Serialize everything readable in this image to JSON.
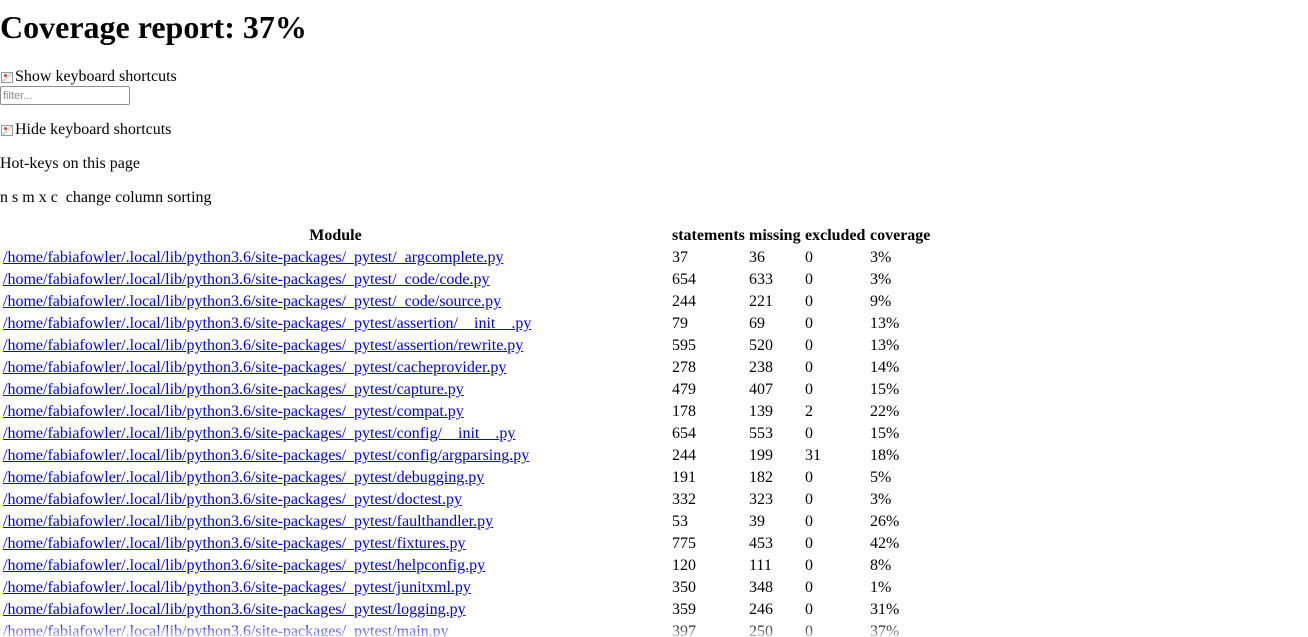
{
  "title": "Coverage report: 37%",
  "show_shortcuts_label": "Show keyboard shortcuts",
  "filter": {
    "placeholder": "filter...",
    "value": ""
  },
  "hide_shortcuts_label": "Hide keyboard shortcuts",
  "hotkeys_heading": "Hot-keys on this page",
  "hotkeys": {
    "keys": [
      "n",
      "s",
      "m",
      "x",
      "c"
    ],
    "description": "change column sorting"
  },
  "table": {
    "columns": [
      "Module",
      "statements",
      "missing",
      "excluded",
      "coverage"
    ],
    "rows": [
      {
        "module": "/home/fabiafowler/.local/lib/python3.6/site-packages/_pytest/_argcomplete.py",
        "statements": "37",
        "missing": "36",
        "excluded": "0",
        "coverage": "3%"
      },
      {
        "module": "/home/fabiafowler/.local/lib/python3.6/site-packages/_pytest/_code/code.py",
        "statements": "654",
        "missing": "633",
        "excluded": "0",
        "coverage": "3%"
      },
      {
        "module": "/home/fabiafowler/.local/lib/python3.6/site-packages/_pytest/_code/source.py",
        "statements": "244",
        "missing": "221",
        "excluded": "0",
        "coverage": "9%"
      },
      {
        "module": "/home/fabiafowler/.local/lib/python3.6/site-packages/_pytest/assertion/__init__.py",
        "statements": "79",
        "missing": "69",
        "excluded": "0",
        "coverage": "13%"
      },
      {
        "module": "/home/fabiafowler/.local/lib/python3.6/site-packages/_pytest/assertion/rewrite.py",
        "statements": "595",
        "missing": "520",
        "excluded": "0",
        "coverage": "13%"
      },
      {
        "module": "/home/fabiafowler/.local/lib/python3.6/site-packages/_pytest/cacheprovider.py",
        "statements": "278",
        "missing": "238",
        "excluded": "0",
        "coverage": "14%"
      },
      {
        "module": "/home/fabiafowler/.local/lib/python3.6/site-packages/_pytest/capture.py",
        "statements": "479",
        "missing": "407",
        "excluded": "0",
        "coverage": "15%"
      },
      {
        "module": "/home/fabiafowler/.local/lib/python3.6/site-packages/_pytest/compat.py",
        "statements": "178",
        "missing": "139",
        "excluded": "2",
        "coverage": "22%"
      },
      {
        "module": "/home/fabiafowler/.local/lib/python3.6/site-packages/_pytest/config/__init__.py",
        "statements": "654",
        "missing": "553",
        "excluded": "0",
        "coverage": "15%"
      },
      {
        "module": "/home/fabiafowler/.local/lib/python3.6/site-packages/_pytest/config/argparsing.py",
        "statements": "244",
        "missing": "199",
        "excluded": "31",
        "coverage": "18%"
      },
      {
        "module": "/home/fabiafowler/.local/lib/python3.6/site-packages/_pytest/debugging.py",
        "statements": "191",
        "missing": "182",
        "excluded": "0",
        "coverage": "5%"
      },
      {
        "module": "/home/fabiafowler/.local/lib/python3.6/site-packages/_pytest/doctest.py",
        "statements": "332",
        "missing": "323",
        "excluded": "0",
        "coverage": "3%"
      },
      {
        "module": "/home/fabiafowler/.local/lib/python3.6/site-packages/_pytest/faulthandler.py",
        "statements": "53",
        "missing": "39",
        "excluded": "0",
        "coverage": "26%"
      },
      {
        "module": "/home/fabiafowler/.local/lib/python3.6/site-packages/_pytest/fixtures.py",
        "statements": "775",
        "missing": "453",
        "excluded": "0",
        "coverage": "42%"
      },
      {
        "module": "/home/fabiafowler/.local/lib/python3.6/site-packages/_pytest/helpconfig.py",
        "statements": "120",
        "missing": "111",
        "excluded": "0",
        "coverage": "8%"
      },
      {
        "module": "/home/fabiafowler/.local/lib/python3.6/site-packages/_pytest/junitxml.py",
        "statements": "350",
        "missing": "348",
        "excluded": "0",
        "coverage": "1%"
      },
      {
        "module": "/home/fabiafowler/.local/lib/python3.6/site-packages/_pytest/logging.py",
        "statements": "359",
        "missing": "246",
        "excluded": "0",
        "coverage": "31%"
      },
      {
        "module": "/home/fabiafowler/.local/lib/python3.6/site-packages/_pytest/main.py",
        "statements": "397",
        "missing": "250",
        "excluded": "0",
        "coverage": "37%"
      }
    ]
  }
}
